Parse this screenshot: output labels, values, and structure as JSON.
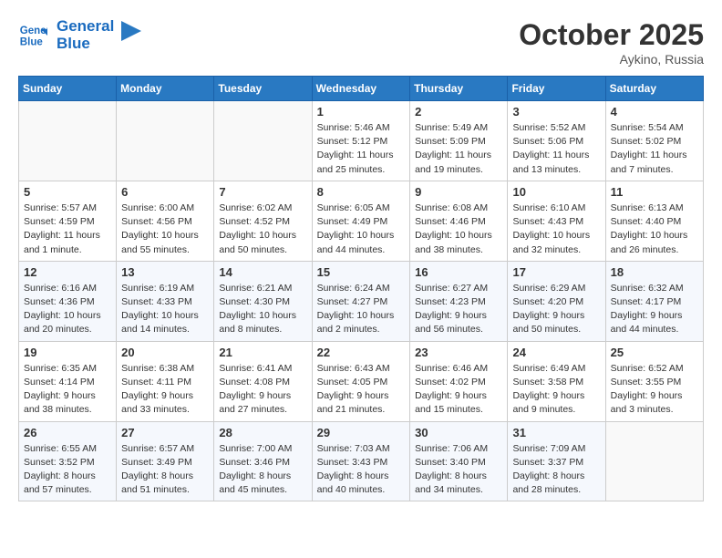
{
  "header": {
    "logo_line1": "General",
    "logo_line2": "Blue",
    "month_title": "October 2025",
    "location": "Aykino, Russia"
  },
  "weekdays": [
    "Sunday",
    "Monday",
    "Tuesday",
    "Wednesday",
    "Thursday",
    "Friday",
    "Saturday"
  ],
  "weeks": [
    [
      {
        "day": "",
        "info": ""
      },
      {
        "day": "",
        "info": ""
      },
      {
        "day": "",
        "info": ""
      },
      {
        "day": "1",
        "info": "Sunrise: 5:46 AM\nSunset: 5:12 PM\nDaylight: 11 hours\nand 25 minutes."
      },
      {
        "day": "2",
        "info": "Sunrise: 5:49 AM\nSunset: 5:09 PM\nDaylight: 11 hours\nand 19 minutes."
      },
      {
        "day": "3",
        "info": "Sunrise: 5:52 AM\nSunset: 5:06 PM\nDaylight: 11 hours\nand 13 minutes."
      },
      {
        "day": "4",
        "info": "Sunrise: 5:54 AM\nSunset: 5:02 PM\nDaylight: 11 hours\nand 7 minutes."
      }
    ],
    [
      {
        "day": "5",
        "info": "Sunrise: 5:57 AM\nSunset: 4:59 PM\nDaylight: 11 hours\nand 1 minute."
      },
      {
        "day": "6",
        "info": "Sunrise: 6:00 AM\nSunset: 4:56 PM\nDaylight: 10 hours\nand 55 minutes."
      },
      {
        "day": "7",
        "info": "Sunrise: 6:02 AM\nSunset: 4:52 PM\nDaylight: 10 hours\nand 50 minutes."
      },
      {
        "day": "8",
        "info": "Sunrise: 6:05 AM\nSunset: 4:49 PM\nDaylight: 10 hours\nand 44 minutes."
      },
      {
        "day": "9",
        "info": "Sunrise: 6:08 AM\nSunset: 4:46 PM\nDaylight: 10 hours\nand 38 minutes."
      },
      {
        "day": "10",
        "info": "Sunrise: 6:10 AM\nSunset: 4:43 PM\nDaylight: 10 hours\nand 32 minutes."
      },
      {
        "day": "11",
        "info": "Sunrise: 6:13 AM\nSunset: 4:40 PM\nDaylight: 10 hours\nand 26 minutes."
      }
    ],
    [
      {
        "day": "12",
        "info": "Sunrise: 6:16 AM\nSunset: 4:36 PM\nDaylight: 10 hours\nand 20 minutes."
      },
      {
        "day": "13",
        "info": "Sunrise: 6:19 AM\nSunset: 4:33 PM\nDaylight: 10 hours\nand 14 minutes."
      },
      {
        "day": "14",
        "info": "Sunrise: 6:21 AM\nSunset: 4:30 PM\nDaylight: 10 hours\nand 8 minutes."
      },
      {
        "day": "15",
        "info": "Sunrise: 6:24 AM\nSunset: 4:27 PM\nDaylight: 10 hours\nand 2 minutes."
      },
      {
        "day": "16",
        "info": "Sunrise: 6:27 AM\nSunset: 4:23 PM\nDaylight: 9 hours\nand 56 minutes."
      },
      {
        "day": "17",
        "info": "Sunrise: 6:29 AM\nSunset: 4:20 PM\nDaylight: 9 hours\nand 50 minutes."
      },
      {
        "day": "18",
        "info": "Sunrise: 6:32 AM\nSunset: 4:17 PM\nDaylight: 9 hours\nand 44 minutes."
      }
    ],
    [
      {
        "day": "19",
        "info": "Sunrise: 6:35 AM\nSunset: 4:14 PM\nDaylight: 9 hours\nand 38 minutes."
      },
      {
        "day": "20",
        "info": "Sunrise: 6:38 AM\nSunset: 4:11 PM\nDaylight: 9 hours\nand 33 minutes."
      },
      {
        "day": "21",
        "info": "Sunrise: 6:41 AM\nSunset: 4:08 PM\nDaylight: 9 hours\nand 27 minutes."
      },
      {
        "day": "22",
        "info": "Sunrise: 6:43 AM\nSunset: 4:05 PM\nDaylight: 9 hours\nand 21 minutes."
      },
      {
        "day": "23",
        "info": "Sunrise: 6:46 AM\nSunset: 4:02 PM\nDaylight: 9 hours\nand 15 minutes."
      },
      {
        "day": "24",
        "info": "Sunrise: 6:49 AM\nSunset: 3:58 PM\nDaylight: 9 hours\nand 9 minutes."
      },
      {
        "day": "25",
        "info": "Sunrise: 6:52 AM\nSunset: 3:55 PM\nDaylight: 9 hours\nand 3 minutes."
      }
    ],
    [
      {
        "day": "26",
        "info": "Sunrise: 6:55 AM\nSunset: 3:52 PM\nDaylight: 8 hours\nand 57 minutes."
      },
      {
        "day": "27",
        "info": "Sunrise: 6:57 AM\nSunset: 3:49 PM\nDaylight: 8 hours\nand 51 minutes."
      },
      {
        "day": "28",
        "info": "Sunrise: 7:00 AM\nSunset: 3:46 PM\nDaylight: 8 hours\nand 45 minutes."
      },
      {
        "day": "29",
        "info": "Sunrise: 7:03 AM\nSunset: 3:43 PM\nDaylight: 8 hours\nand 40 minutes."
      },
      {
        "day": "30",
        "info": "Sunrise: 7:06 AM\nSunset: 3:40 PM\nDaylight: 8 hours\nand 34 minutes."
      },
      {
        "day": "31",
        "info": "Sunrise: 7:09 AM\nSunset: 3:37 PM\nDaylight: 8 hours\nand 28 minutes."
      },
      {
        "day": "",
        "info": ""
      }
    ]
  ]
}
